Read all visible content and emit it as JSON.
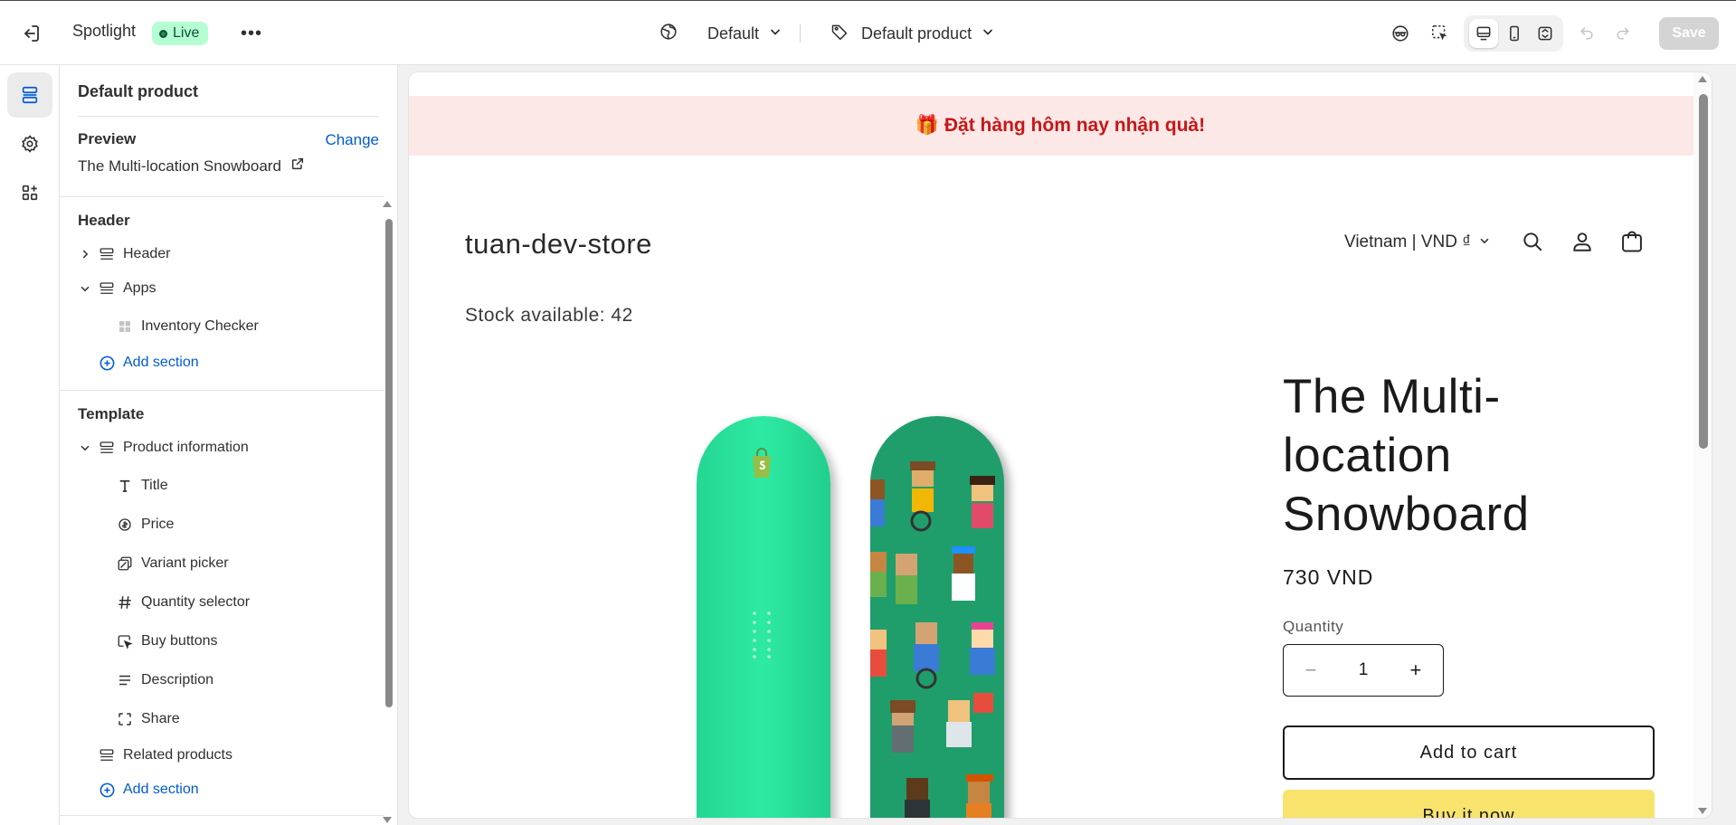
{
  "topbar": {
    "theme_name": "Spotlight",
    "status_badge": "Live",
    "more_label": "•••",
    "template_selector": "Default",
    "product_selector": "Default product",
    "save_label": "Save"
  },
  "sidebar": {
    "title": "Default product",
    "preview": {
      "label": "Preview",
      "change_link": "Change",
      "product_name": "The Multi-location Snowboard"
    },
    "header_group": {
      "title": "Header",
      "items": [
        {
          "label": "Header",
          "icon": "section-icon",
          "expandable": true,
          "expanded": false
        },
        {
          "label": "Apps",
          "icon": "section-icon",
          "expandable": true,
          "expanded": true
        }
      ],
      "app_block": "Inventory Checker",
      "add_section": "Add section"
    },
    "template_group": {
      "title": "Template",
      "section": "Product information",
      "blocks": [
        {
          "label": "Title",
          "icon": "text-icon"
        },
        {
          "label": "Price",
          "icon": "price-tag-icon"
        },
        {
          "label": "Variant picker",
          "icon": "variant-icon"
        },
        {
          "label": "Quantity selector",
          "icon": "hash-icon"
        },
        {
          "label": "Buy buttons",
          "icon": "cursor-click-icon"
        },
        {
          "label": "Description",
          "icon": "text-align-icon"
        },
        {
          "label": "Share",
          "icon": "share-frame-icon"
        }
      ],
      "related": "Related products",
      "add_section": "Add section"
    }
  },
  "preview": {
    "announcement": "🎁 Đặt hàng hôm nay nhận quà!",
    "store_name": "tuan-dev-store",
    "country_selector": "Vietnam | VND ₫",
    "stock_text": "Stock available: 42",
    "product_title": "The Multi-location Snowboard",
    "price": "730 VND",
    "quantity_label": "Quantity",
    "quantity_value": "1",
    "minus_label": "−",
    "plus_label": "+",
    "add_to_cart": "Add to cart",
    "buy_now": "Buy it now"
  },
  "colors": {
    "accent_link": "#005bd3",
    "live_badge_bg": "#b4fed2",
    "announcement_bg": "#fde8e8",
    "announcement_text": "#c81616",
    "buy_now_bg": "#f8e46c"
  }
}
